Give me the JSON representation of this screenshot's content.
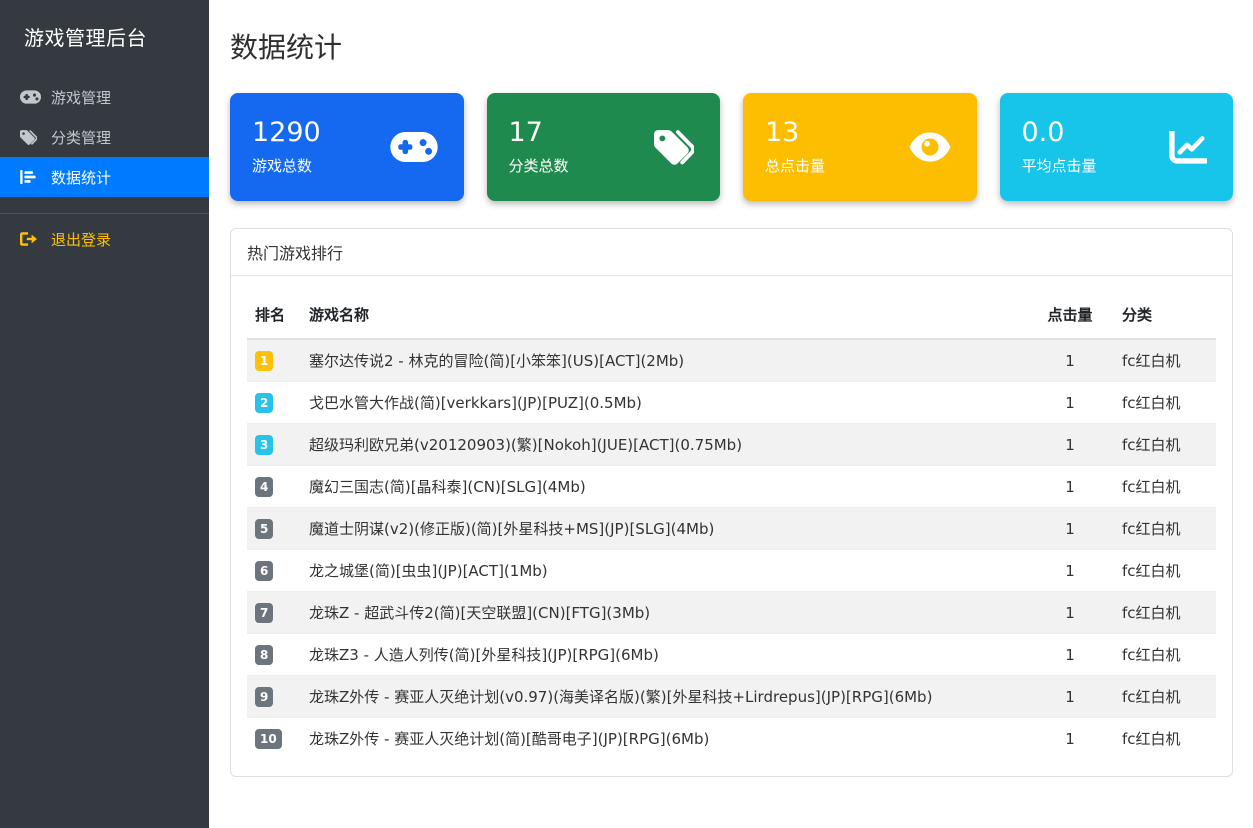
{
  "sidebar": {
    "title": "游戏管理后台",
    "items": [
      {
        "label": "游戏管理",
        "icon": "gamepad-icon",
        "active": false
      },
      {
        "label": "分类管理",
        "icon": "tags-icon",
        "active": false
      },
      {
        "label": "数据统计",
        "icon": "chart-bar-icon",
        "active": true
      }
    ],
    "logout_label": "退出登录",
    "colors": {
      "active_bg": "#007bff",
      "logout_text": "#ffc107",
      "background": "#343a40"
    }
  },
  "main": {
    "page_title": "数据统计",
    "stat_cards": [
      {
        "value": "1290",
        "label": "游戏总数",
        "color": "#1569f0",
        "icon": "gamepad-icon"
      },
      {
        "value": "17",
        "label": "分类总数",
        "color": "#1f8a4d",
        "icon": "tags-icon"
      },
      {
        "value": "13",
        "label": "总点击量",
        "color": "#fdbe02",
        "icon": "eye-icon"
      },
      {
        "value": "0.0",
        "label": "平均点击量",
        "color": "#18c5ea",
        "icon": "chart-line-icon"
      }
    ],
    "panel": {
      "title": "热门游戏排行",
      "table": {
        "headers": [
          "排名",
          "游戏名称",
          "点击量",
          "分类"
        ],
        "rows": [
          {
            "rank": "1",
            "badge_color": "#ffc107",
            "name": "塞尔达传说2 - 林克的冒险(简)[小笨笨](US)[ACT](2Mb)",
            "clicks": "1",
            "category": "fc红白机"
          },
          {
            "rank": "2",
            "badge_color": "#29c2ea",
            "name": "戈巴水管大作战(简)[verkkars](JP)[PUZ](0.5Mb)",
            "clicks": "1",
            "category": "fc红白机"
          },
          {
            "rank": "3",
            "badge_color": "#29c2ea",
            "name": "超级玛利欧兄弟(v20120903)(繁)[Nokoh](JUE)[ACT](0.75Mb)",
            "clicks": "1",
            "category": "fc红白机"
          },
          {
            "rank": "4",
            "badge_color": "#6c757d",
            "name": "魔幻三国志(简)[晶科泰](CN)[SLG](4Mb)",
            "clicks": "1",
            "category": "fc红白机"
          },
          {
            "rank": "5",
            "badge_color": "#6c757d",
            "name": "魔道士阴谋(v2)(修正版)(简)[外星科技+MS](JP)[SLG](4Mb)",
            "clicks": "1",
            "category": "fc红白机"
          },
          {
            "rank": "6",
            "badge_color": "#6c757d",
            "name": "龙之城堡(简)[虫虫](JP)[ACT](1Mb)",
            "clicks": "1",
            "category": "fc红白机"
          },
          {
            "rank": "7",
            "badge_color": "#6c757d",
            "name": "龙珠Z - 超武斗传2(简)[天空联盟](CN)[FTG](3Mb)",
            "clicks": "1",
            "category": "fc红白机"
          },
          {
            "rank": "8",
            "badge_color": "#6c757d",
            "name": "龙珠Z3 - 人造人列传(简)[外星科技](JP)[RPG](6Mb)",
            "clicks": "1",
            "category": "fc红白机"
          },
          {
            "rank": "9",
            "badge_color": "#6c757d",
            "name": "龙珠Z外传 - 赛亚人灭绝计划(v0.97)(海美译名版)(繁)[外星科技+Lirdrepus](JP)[RPG](6Mb)",
            "clicks": "1",
            "category": "fc红白机"
          },
          {
            "rank": "10",
            "badge_color": "#6c757d",
            "name": "龙珠Z外传 - 赛亚人灭绝计划(简)[酷哥电子](JP)[RPG](6Mb)",
            "clicks": "1",
            "category": "fc红白机"
          }
        ]
      }
    }
  }
}
